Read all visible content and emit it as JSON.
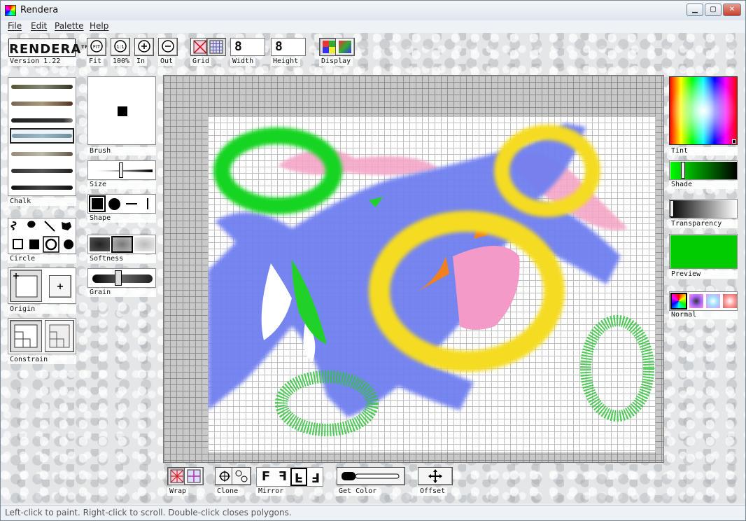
{
  "window": {
    "title": "Rendera"
  },
  "menu": [
    {
      "label": "File"
    },
    {
      "label": "Edit"
    },
    {
      "label": "Palette"
    },
    {
      "label": "Help"
    }
  ],
  "logo": {
    "text": "RENDERA",
    "tm": "TM",
    "version": "Version 1.22"
  },
  "toolbar": {
    "fit": "Fit",
    "fit_glyph": "FIT",
    "zoom100": "100%",
    "zoom100_glyph": "1:1",
    "zoom_in": "In",
    "zoom_out": "Out",
    "grid": "Grid",
    "width_label": "Width",
    "width_value": "8",
    "height_label": "Height",
    "height_value": "8",
    "display": "Display"
  },
  "brush_panel": {
    "selected_label": "Chalk"
  },
  "brush_options": {
    "brush_label": "Brush",
    "size_label": "Size",
    "shape_label": "Shape",
    "softness_label": "Softness",
    "grain_label": "Grain"
  },
  "tools": {
    "selected_label": "Circle"
  },
  "origin": {
    "label": "Origin"
  },
  "constrain": {
    "label": "Constrain"
  },
  "bottom_bar": {
    "wrap": "Wrap",
    "clone": "Clone",
    "mirror": "Mirror",
    "get_color": "Get Color",
    "offset": "Offset"
  },
  "color_panel": {
    "tint_label": "Tint",
    "shade_label": "Shade",
    "transparency_label": "Transparency",
    "preview_label": "Preview",
    "preview_color": "#00cc00",
    "mode_label": "Normal"
  },
  "status": "Left-click to paint. Right-click to scroll. Double-click closes polygons."
}
